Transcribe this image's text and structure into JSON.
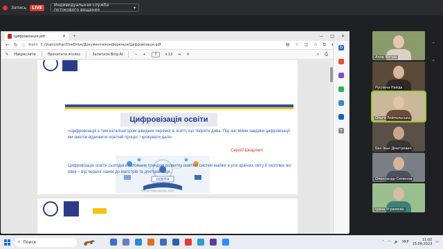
{
  "topbar": {
    "record_label": "Запись",
    "live_label": "LIVE",
    "stream_service": "Индивидуальная служба потокового вещания"
  },
  "browser": {
    "tab_title": "Цифровізація.pdf",
    "file_label": "Файл",
    "url": "C:/Users/olhar/OneDrive/Документи/конференція/Цифровізація.pdf"
  },
  "pdf_toolbar": {
    "annotations_label": "Накреслити",
    "read_aloud_label": "Прочитати вголос",
    "ask_bing_label": "Запитати Bing AI",
    "page_current": "3",
    "page_total": "з 12"
  },
  "slide": {
    "title": "Цифровізація освіти",
    "quote": "«Цифровізація є тим каталізатором швидких перемог в освіті, що творять дива. Під час війни завдяки цифровізації ми змогли відновити освітній процес і крокувати далі».",
    "quote_author": "Сергій Шкарлет",
    "illustration_caption": "ОСВІТА",
    "body": "Цифровізація освіти сьогодні є головним трендом розвитку освітніх систем майже в усіх країнах світу й охоплює всі рівні – від першої ланки до магістрів та докторів наук.",
    "footer_author": "Ольга Рейпольська, 2023"
  },
  "participants": [
    {
      "name": "Алла Богуш",
      "bg": "#8a9a6b",
      "shirt": "#d9d3c4",
      "skin": "#e7c6b0"
    },
    {
      "name": "Руслана Найда",
      "bg": "#5b4a3a",
      "shirt": "#2e2a28",
      "skin": "#d9b59c"
    },
    {
      "name": "Ольга Рейпольська",
      "bg": "#c9b99a",
      "shirt": "#6b4c3b",
      "skin": "#e2c2a8"
    },
    {
      "name": "Бех Іван Дмитрович",
      "bg": "#5a5048",
      "shirt": "#3a3634",
      "skin": "#c8a58c"
    },
    {
      "name": "Олександр Семенов",
      "bg": "#7a7f85",
      "shirt": "#4a5260",
      "skin": "#d6b49b"
    },
    {
      "name": "Ірина Угрюмова",
      "bg": "#9abf8e",
      "shirt": "#3f7f7a",
      "skin": "#d9bca5"
    }
  ],
  "taskbar": {
    "search_placeholder": "Поиск",
    "language": "УКР",
    "time": "11:02",
    "date": "15.09.2023"
  }
}
